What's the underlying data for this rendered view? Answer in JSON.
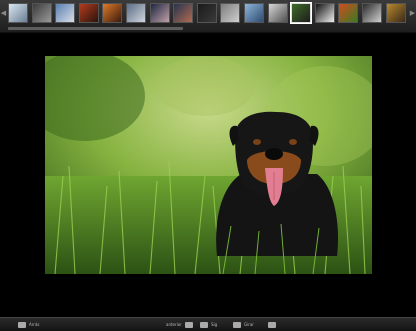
{
  "strip": {
    "prev_arrow": "◀",
    "next_arrow": "▶",
    "thumbnails": [
      {
        "name": "thumb-1",
        "colors": [
          "#d9e6f0",
          "#6a7f95"
        ]
      },
      {
        "name": "thumb-2",
        "colors": [
          "#3c3c3c",
          "#999999"
        ]
      },
      {
        "name": "thumb-3",
        "colors": [
          "#5a7fb0",
          "#d8dde6"
        ]
      },
      {
        "name": "thumb-4",
        "colors": [
          "#b23b1e",
          "#2a140d"
        ]
      },
      {
        "name": "thumb-5",
        "colors": [
          "#e07a2a",
          "#3a1b0e"
        ]
      },
      {
        "name": "thumb-6",
        "colors": [
          "#5c6d86",
          "#cfd5dd"
        ]
      },
      {
        "name": "thumb-7",
        "colors": [
          "#1e2740",
          "#c0a0a8"
        ]
      },
      {
        "name": "thumb-8",
        "colors": [
          "#27344f",
          "#b06a50"
        ]
      },
      {
        "name": "thumb-9",
        "colors": [
          "#1a1a1a",
          "#3a3a3a"
        ]
      },
      {
        "name": "thumb-10",
        "colors": [
          "#7d7d7d",
          "#cfcfcf"
        ]
      },
      {
        "name": "thumb-11",
        "colors": [
          "#8fb3d9",
          "#2e4d70"
        ]
      },
      {
        "name": "thumb-12",
        "colors": [
          "#d6d6d6",
          "#505050"
        ]
      },
      {
        "name": "thumb-13",
        "colors": [
          "#3f6b2a",
          "#1d1d1d"
        ]
      },
      {
        "name": "thumb-14",
        "colors": [
          "#101010",
          "#f0f0f0"
        ]
      },
      {
        "name": "thumb-15",
        "colors": [
          "#cf4d1f",
          "#3c7a25"
        ]
      },
      {
        "name": "thumb-16",
        "colors": [
          "#2a2a2a",
          "#d0d0d0"
        ]
      },
      {
        "name": "thumb-17",
        "colors": [
          "#b8892e",
          "#3a2a1a"
        ]
      }
    ],
    "active_index": 12
  },
  "bottom_bar": {
    "left_label": "Arrás",
    "prev_label": "anterior",
    "next_label": "Sig",
    "edit_label": "Girar",
    "right_label": ""
  },
  "colors": {
    "background": "#000000",
    "grass_dark": "#2f5a17",
    "grass_light": "#86b340",
    "dog_fur": "#141414",
    "dog_tan": "#8a4b1c",
    "tongue": "#e27e92"
  }
}
